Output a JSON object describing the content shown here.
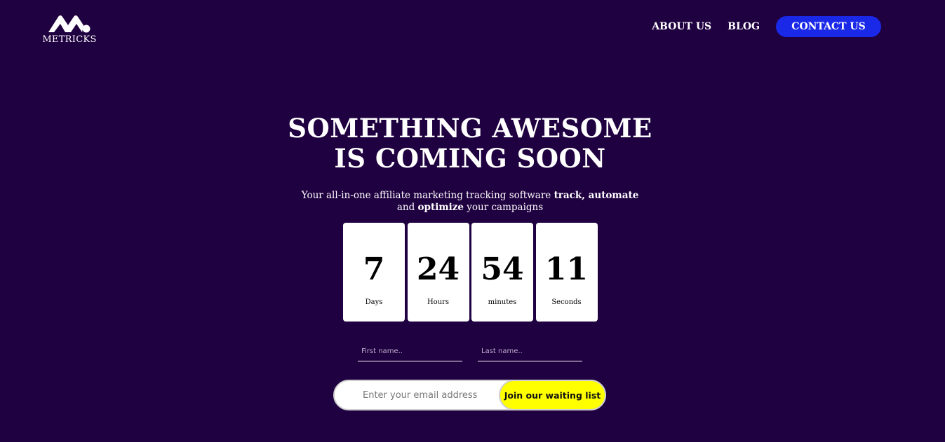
{
  "brand": {
    "logo_icon": "metricks-logo-icon",
    "name": "METRICKS"
  },
  "nav": {
    "about": "ABOUT US",
    "blog": "BLOG",
    "contact": "CONTACT US"
  },
  "hero": {
    "title_line1": "SOMETHING AWESOME",
    "title_line2": "IS COMING SOON",
    "subtitle_part1": "Your all-in-one affiliate marketing tracking software ",
    "subtitle_bold1": "track, automate",
    "subtitle_part2": "and ",
    "subtitle_bold2": "optimize",
    "subtitle_part3": " your campaigns"
  },
  "countdown": [
    {
      "value": "7",
      "label": "Days"
    },
    {
      "value": "24",
      "label": "Hours"
    },
    {
      "value": "54",
      "label": "minutes"
    },
    {
      "value": "11",
      "label": "Seconds"
    }
  ],
  "form": {
    "first_name_placeholder": "First name..",
    "first_name_value": "",
    "last_name_placeholder": "Last name..",
    "last_name_value": "",
    "email_placeholder": "Enter your email address",
    "email_value": "",
    "submit_label": "Join our waiting list"
  },
  "colors": {
    "background": "#1f0040",
    "contact_button": "#1a28e8",
    "join_button": "#ffff00",
    "card": "#ffffff"
  }
}
